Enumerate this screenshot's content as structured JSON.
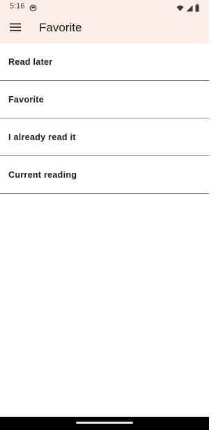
{
  "status_bar": {
    "time": "5:16",
    "icons": [
      "notification-icon",
      "wifi-icon",
      "signal-icon",
      "battery-icon"
    ]
  },
  "app_bar": {
    "title": "Favorite",
    "menu_icon": "menu-icon",
    "background": "#fcefe8"
  },
  "list": {
    "items": [
      {
        "label": "Read later"
      },
      {
        "label": "Favorite"
      },
      {
        "label": "I already read it"
      },
      {
        "label": "Current reading"
      }
    ]
  }
}
